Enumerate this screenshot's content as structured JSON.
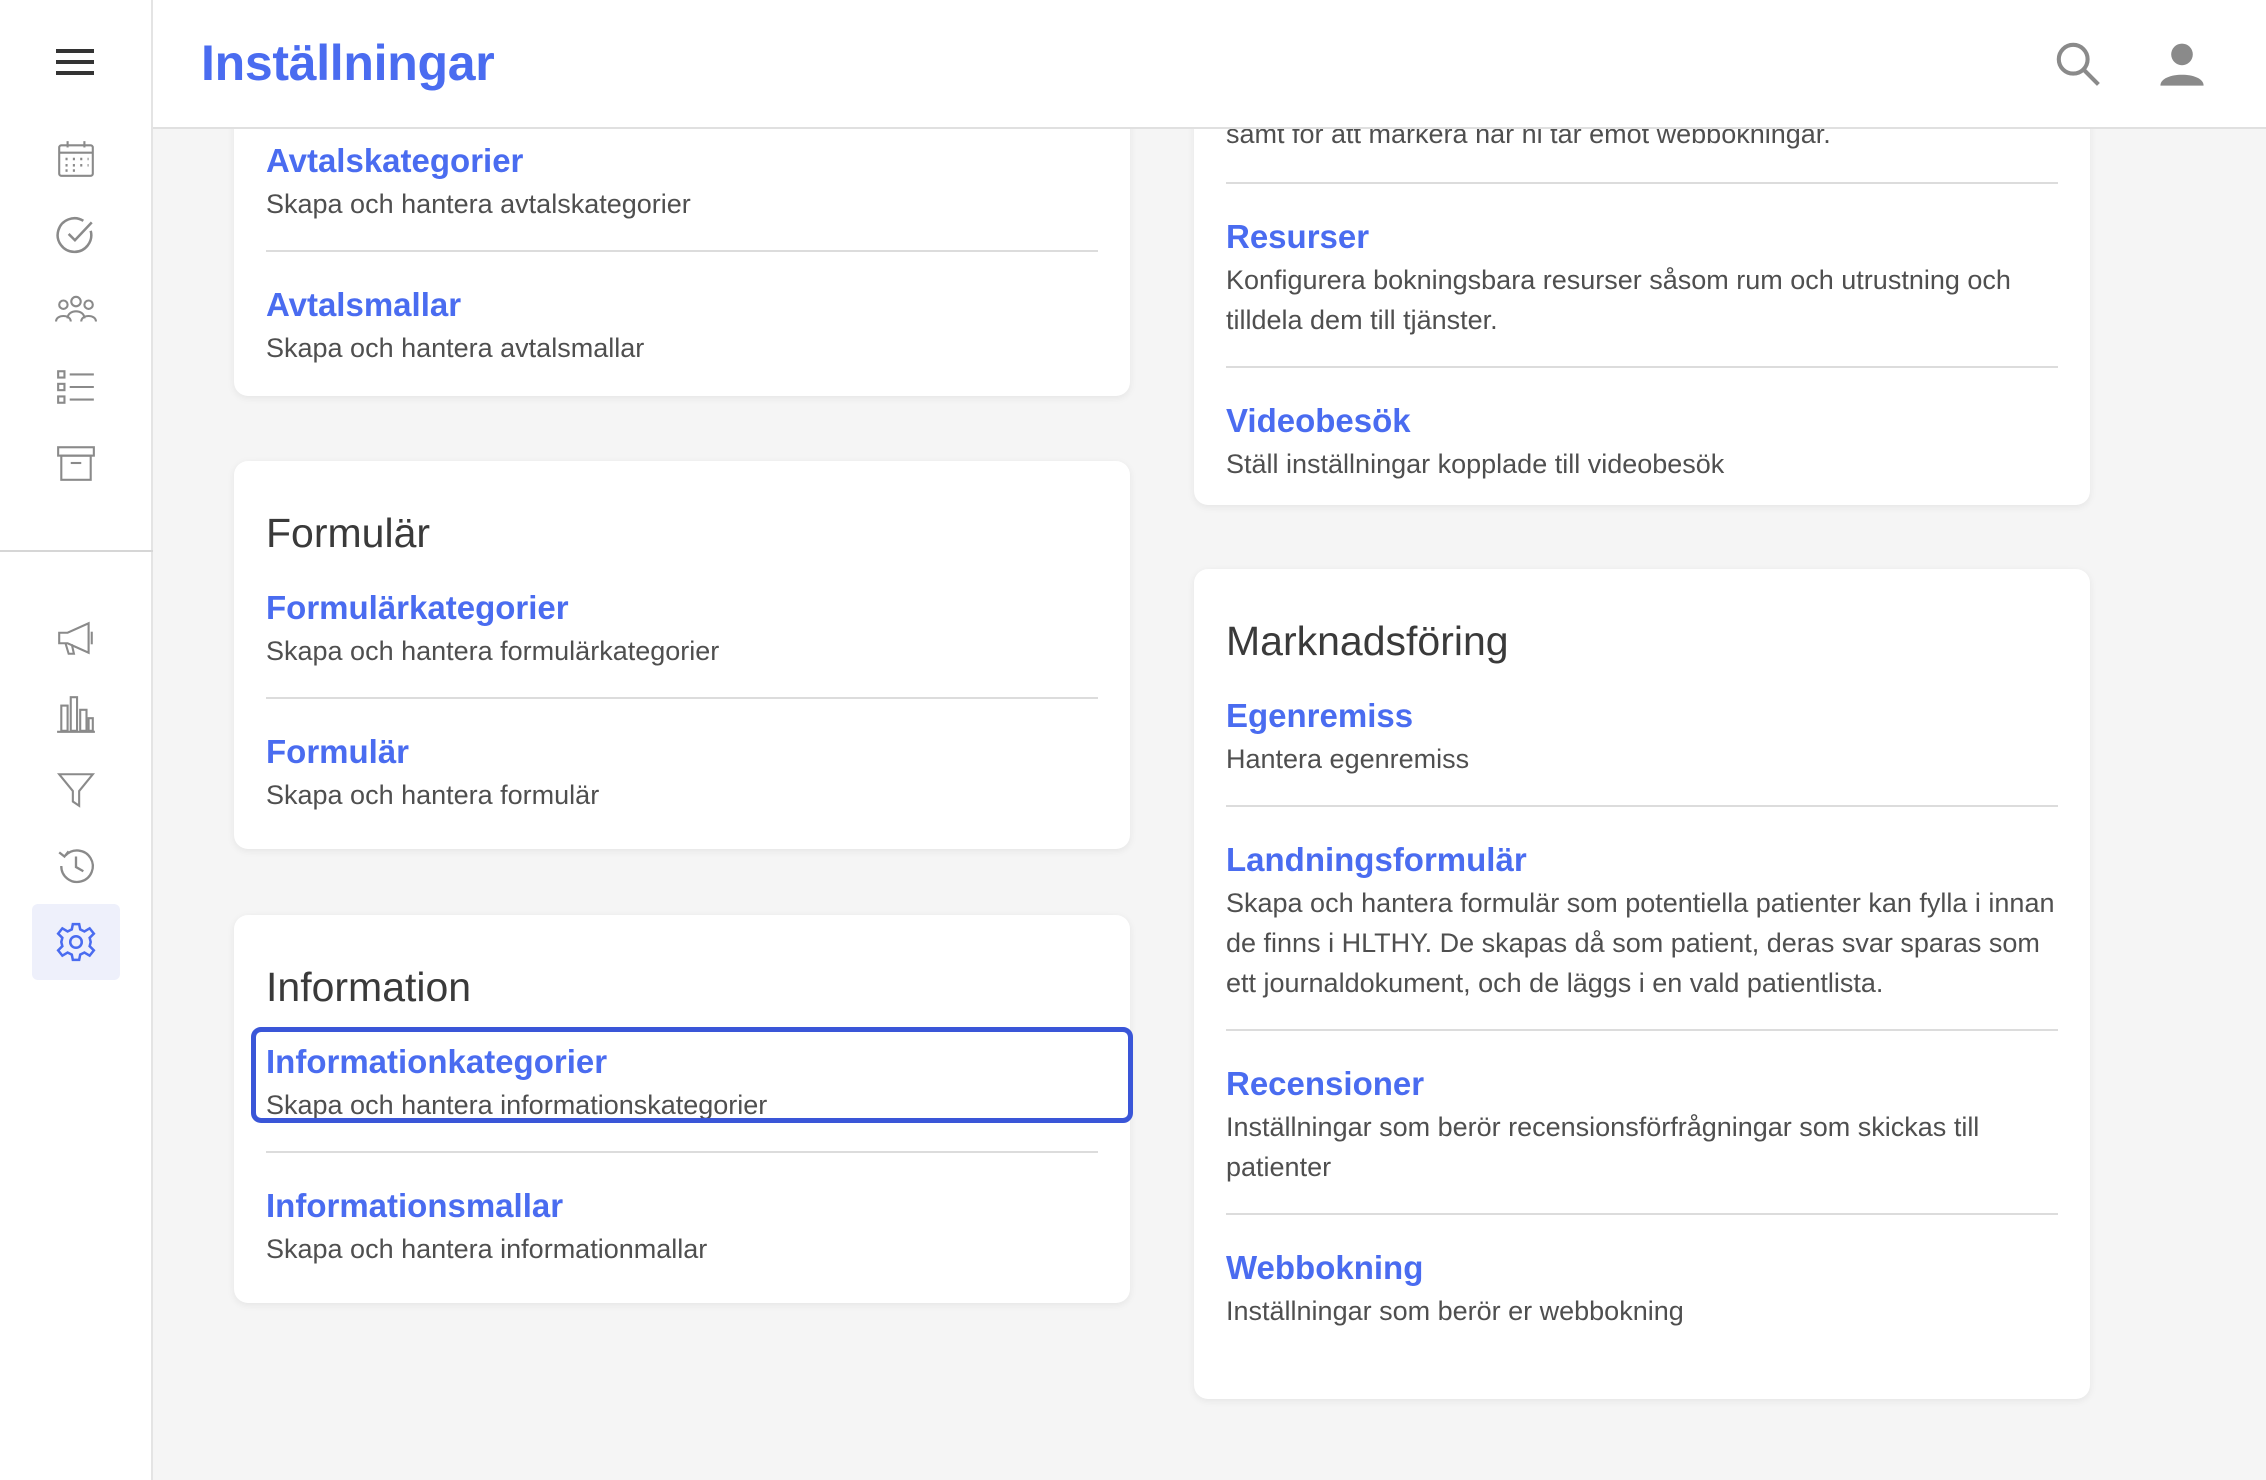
{
  "header": {
    "title": "Inställningar",
    "search_icon": "search-icon",
    "account_icon": "account-icon"
  },
  "colors": {
    "accent": "#4a6cf0",
    "focus_outline": "#3a56d8",
    "background": "#f5f5f5"
  },
  "sidebar": {
    "top_items": [
      "calendar-icon",
      "check-circle-icon",
      "group-icon",
      "list-icon",
      "archive-icon"
    ],
    "bottom_items": [
      "megaphone-icon",
      "bar-chart-icon",
      "filter-icon",
      "history-icon",
      "gear-icon"
    ],
    "active": "gear-icon"
  },
  "left_column": {
    "card1": {
      "items": [
        {
          "title": "Avtalskategorier",
          "desc": "Skapa och hantera avtalskategorier"
        },
        {
          "title": "Avtalsmallar",
          "desc": "Skapa och hantera avtalsmallar"
        }
      ]
    },
    "formular": {
      "title": "Formulär",
      "items": [
        {
          "title": "Formulärkategorier",
          "desc": "Skapa och hantera formulärkategorier"
        },
        {
          "title": "Formulär",
          "desc": "Skapa och hantera formulär"
        }
      ]
    },
    "information": {
      "title": "Information",
      "items": [
        {
          "title": "Informationkategorier",
          "desc": "Skapa och hantera informationskategorier"
        },
        {
          "title": "Informationsmallar",
          "desc": "Skapa och hantera informationmallar"
        }
      ]
    }
  },
  "right_column": {
    "card1": {
      "cut_text": "samt för att markera när ni tar emot webbokningar.",
      "items": [
        {
          "title": "Resurser",
          "desc": "Konfigurera bokningsbara resurser såsom rum och utrustning och tilldela dem till tjänster."
        },
        {
          "title": "Videobesök",
          "desc": "Ställ inställningar kopplade till videobesök"
        }
      ]
    },
    "marknadsforing": {
      "title": "Marknadsföring",
      "items": [
        {
          "title": "Egenremiss",
          "desc": "Hantera egenremiss"
        },
        {
          "title": "Landningsformulär",
          "desc": "Skapa och hantera formulär som potentiella patienter kan fylla i innan de finns i HLTHY. De skapas då som patient, deras svar sparas som ett journaldokument, och de läggs i en vald patientlista."
        },
        {
          "title": "Recensioner",
          "desc": "Inställningar som berör recensionsförfrågningar som skickas till patienter"
        },
        {
          "title": "Webbokning",
          "desc": "Inställningar som berör er webbokning"
        }
      ]
    }
  }
}
